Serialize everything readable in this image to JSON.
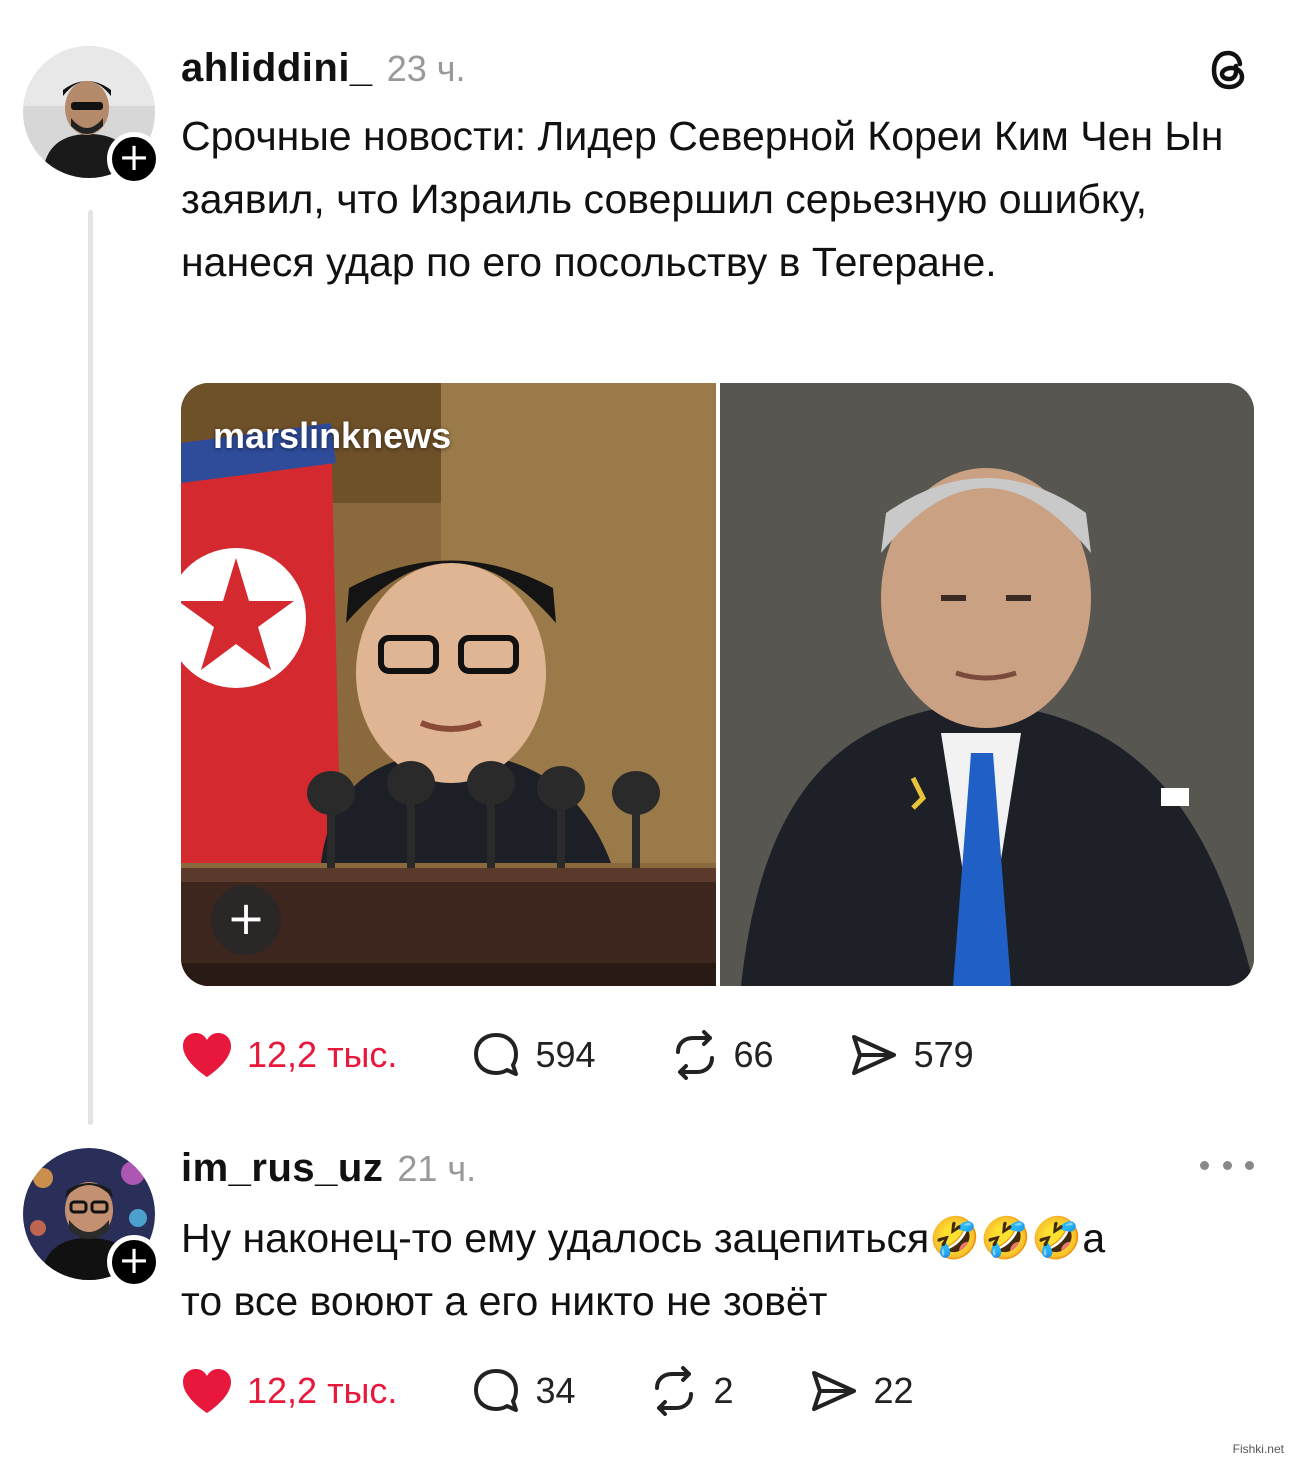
{
  "post": {
    "username": "ahliddini_",
    "time": "23 ч.",
    "text": "Срочные новости: Лидер Северной Кореи Ким Чен Ын заявил, что Израиль совершил серьезную ошибку, нанеся удар по его посольству в Тегеране.",
    "media_watermark": "marslinknews",
    "likes": "12,2 тыс.",
    "comments": "594",
    "reposts": "66",
    "shares": "579"
  },
  "reply": {
    "username": "im_rus_uz",
    "time": "21 ч.",
    "text_line1": "Ну наконец-то ему удалось зацепиться",
    "emojis": "🤣🤣🤣",
    "text_line1_end": "а",
    "text_line2": "то все воюют а его никто не зовёт",
    "likes": "12,2 тыс.",
    "comments": "34",
    "reposts": "2",
    "shares": "22"
  },
  "icons": {
    "logo": "threads-logo-icon",
    "like": "heart-icon",
    "comment": "comment-bubble-icon",
    "repost": "repost-icon",
    "share": "send-icon",
    "follow": "plus-icon",
    "more": "more-dots-icon"
  },
  "colors": {
    "like": "#e8173c",
    "muted": "#999999",
    "thread_line": "#e3e3e3"
  },
  "site_mark": "Fishki.net"
}
